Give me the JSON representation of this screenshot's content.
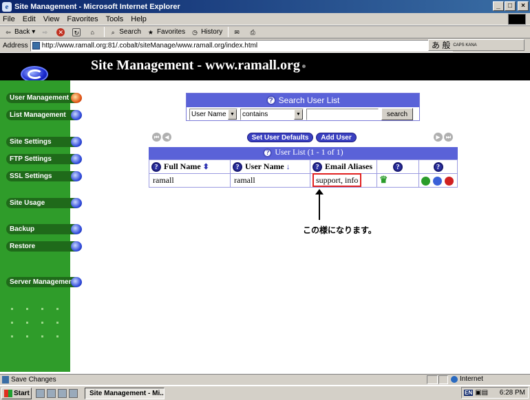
{
  "window": {
    "title": "Site Management - Microsoft Internet Explorer",
    "controls": [
      "_",
      "□",
      "×"
    ]
  },
  "menu": [
    "File",
    "Edit",
    "View",
    "Favorites",
    "Tools",
    "Help"
  ],
  "toolbar": {
    "back": "Back",
    "search": "Search",
    "favorites": "Favorites",
    "history": "History"
  },
  "address": {
    "label": "Address",
    "url": "http://www.ramall.org:81/.cobalt/siteManage/www.ramall.org/index.html"
  },
  "ime": {
    "glyphs": "あ 般",
    "caps": "CAPS KANA"
  },
  "header": {
    "title": "Site Management - www.ramall.org"
  },
  "sidebar": {
    "items": [
      {
        "label": "User Management",
        "active": true
      },
      {
        "label": "List Management",
        "active": false
      },
      {
        "label": "Site Settings",
        "active": false
      },
      {
        "label": "FTP Settings",
        "active": false
      },
      {
        "label": "SSL Settings",
        "active": false
      },
      {
        "label": "Site Usage",
        "active": false
      },
      {
        "label": "Backup",
        "active": false
      },
      {
        "label": "Restore",
        "active": false
      },
      {
        "label": "Server Management",
        "active": false
      }
    ]
  },
  "search": {
    "title": "Search User List",
    "field_select": "User Name",
    "op_select": "contains",
    "query": "",
    "button": "search"
  },
  "actions": {
    "set_defaults": "Set User Defaults",
    "add_user": "Add User"
  },
  "user_table": {
    "caption": "User List (1 - 1 of 1)",
    "headers": {
      "full_name": "Full Name",
      "user_name": "User Name",
      "email_aliases": "Email Aliases"
    },
    "rows": [
      {
        "full_name": "ramall",
        "user_name": "ramall",
        "email_aliases": "support, info"
      }
    ]
  },
  "annotation": {
    "note": "この様になります。"
  },
  "status": {
    "text": "Save Changes",
    "zone": "Internet"
  },
  "taskbar": {
    "start": "Start",
    "task": "Site Management - Mi...",
    "lang": "EN",
    "time": "6:28 PM"
  },
  "colors": {
    "sidebar_green": "#2f9c2a",
    "panel_blue": "#5a62d8",
    "accent_red": "#e02020",
    "header_black": "#000000"
  }
}
